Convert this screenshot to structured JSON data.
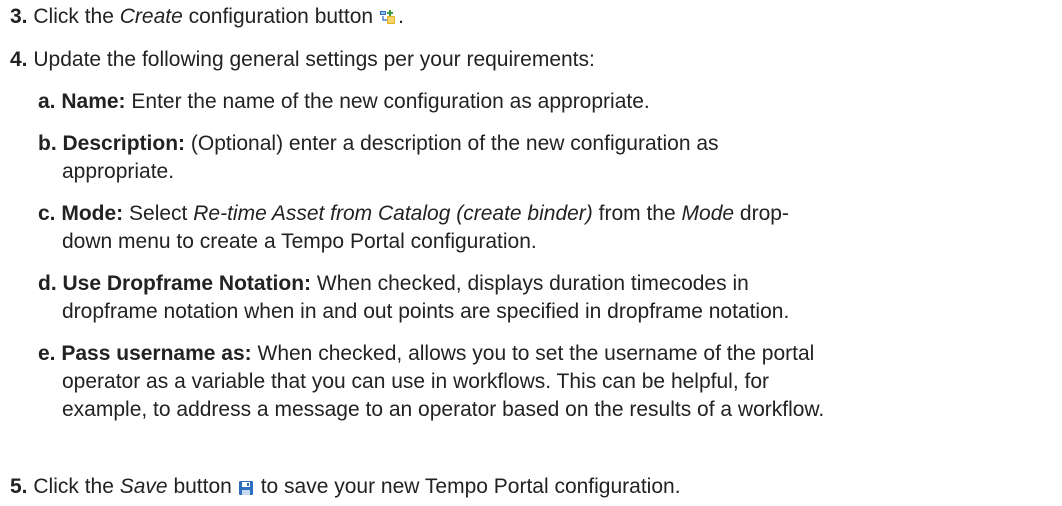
{
  "steps": {
    "s3": {
      "num": "3.",
      "pre": "Click the",
      "em": "Create",
      "post": "configuration button",
      "end": ".",
      "icon": "create-configuration-icon"
    },
    "s4": {
      "num": "4.",
      "text": "Update the following general settings per your requirements:"
    },
    "s5": {
      "num": "5.",
      "pre": "Click the",
      "em": "Save",
      "post": "button",
      "end": "to save your new Tempo Portal configuration.",
      "icon": "save-icon"
    }
  },
  "substeps": {
    "a": {
      "letter": "a.",
      "term": "Name:",
      "text": "Enter the name of the new configuration as appropriate."
    },
    "b": {
      "letter": "b.",
      "term": "Description:",
      "line1": "(Optional) enter a description of the new configuration as",
      "line2": "appropriate."
    },
    "c": {
      "letter": "c.",
      "term": "Mode:",
      "t1": "Select",
      "em1": "Re-time Asset from Catalog (create binder)",
      "t2": "from the",
      "em2": "Mode",
      "t3": "drop-",
      "line2": "down menu to create a Tempo Portal configuration."
    },
    "d": {
      "letter": "d.",
      "term": "Use Dropframe Notation:",
      "line1": "When checked, displays duration timecodes in",
      "line2": "dropframe notation when in and out points are specified in dropframe notation."
    },
    "e": {
      "letter": "e.",
      "term": "Pass username as:",
      "line1": "When checked, allows you to set the username of the portal",
      "line2": "operator as a variable that you can use in workflows. This can be helpful, for",
      "line3": "example, to address a message to an operator based on the results of a workflow."
    }
  },
  "colors": {
    "text": "#222222",
    "icon_blue": "#2f6fc0",
    "icon_gold": "#e0b020"
  }
}
